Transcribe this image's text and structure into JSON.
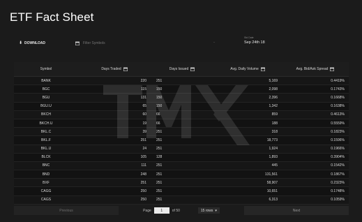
{
  "header": {
    "title": "ETF Fact Sheet"
  },
  "toolbar": {
    "download_label": "DOWNLOAD",
    "filter_placeholder": "Filter Symbols",
    "separator": "-",
    "date_label": "Std Date",
    "date_value": "Sep 24th 18"
  },
  "table": {
    "columns": [
      "Symbol",
      "Days Traded",
      "Days Issued",
      "Avg. Daily Volume",
      "Avg. Bid/Ask Spread"
    ],
    "rows": [
      [
        "BANK",
        "220",
        "251",
        "5,169",
        "0.4419%"
      ],
      [
        "BGC",
        "115",
        "150",
        "2,098",
        "0.1743%"
      ],
      [
        "BGU",
        "131",
        "150",
        "2,396",
        "0.1668%"
      ],
      [
        "BGU.U",
        "65",
        "150",
        "1,342",
        "0.1638%"
      ],
      [
        "BKCH",
        "60",
        "66",
        "859",
        "0.4613%"
      ],
      [
        "BKCH.U",
        "19",
        "66",
        "188",
        "0.5559%"
      ],
      [
        "BKL.C",
        "39",
        "251",
        "318",
        "0.1823%"
      ],
      [
        "BKL.F",
        "251",
        "251",
        "18,773",
        "0.1596%"
      ],
      [
        "BKL.U",
        "24",
        "251",
        "1,924",
        "0.1966%"
      ],
      [
        "BLCK",
        "105",
        "128",
        "1,893",
        "0.3904%"
      ],
      [
        "BNC",
        "111",
        "251",
        "445",
        "0.1542%"
      ],
      [
        "BND",
        "248",
        "251",
        "131,561",
        "0.1867%"
      ],
      [
        "BXF",
        "251",
        "251",
        "58,907",
        "0.2323%"
      ],
      [
        "CAGG",
        "250",
        "251",
        "10,651",
        "0.1748%"
      ],
      [
        "CAGS",
        "250",
        "251",
        "6,313",
        "0.1059%"
      ]
    ]
  },
  "watermark": {
    "text": "TMX"
  },
  "pagination": {
    "previous_label": "Previous",
    "page_label": "Page",
    "page_value": "1",
    "of_label": "of 50",
    "rows_label": "15 rows",
    "next_label": "Next"
  },
  "icons": {
    "download": "download-icon",
    "calendar": "calendar-icon",
    "dropdown": "chevron-down-icon"
  }
}
